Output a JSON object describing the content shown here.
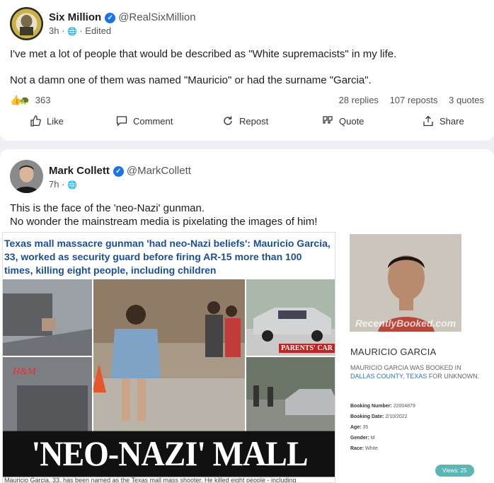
{
  "post1": {
    "author": "Six Million",
    "handle": "@RealSixMillion",
    "time": "3h",
    "edited": "Edited",
    "line1": "I've met a lot of people that would be described as \"White supremacists\" in my life.",
    "line2": "Not a damn one of them was named \"Mauricio\" or had the surname \"Garcia\".",
    "reactions_count": "363",
    "replies": "28 replies",
    "reposts": "107 reposts",
    "quotes": "3 quotes",
    "actions": {
      "like": "Like",
      "comment": "Comment",
      "repost": "Repost",
      "quote": "Quote",
      "share": "Share"
    }
  },
  "post2": {
    "author": "Mark Collett",
    "handle": "@MarkCollett",
    "time": "7h",
    "line1": "This is the face of the 'neo-Nazi' gunman.",
    "line2": "No wonder the mainstream media is pixelating the images of him!"
  },
  "news": {
    "headline": "Texas mall massacre gunman 'had neo-Nazi beliefs': Mauricio Garcia, 33, worked as security guard before firing AR-15 more than 100 times, killing eight people, including children",
    "parents_car": "PARENTS' CAR",
    "big_title": "'NEO-NAZI' MALL GUNMAN",
    "caption": "Mauricio Garcia, 33, has been named as the Texas mall mass shooter. He killed eight people - including",
    "store_sign": "H&M"
  },
  "booking": {
    "watermark": "RecentlyBooked.com",
    "name": "MAURICIO GARCIA",
    "desc_pre": "MAURICIO GARCIA WAS BOOKED IN",
    "desc_link": "DALLAS COUNTY, TEXAS",
    "desc_post": "FOR UNKNOWN.",
    "booking_number_label": "Booking Number:",
    "booking_number": "22004879",
    "booking_date_label": "Booking Date:",
    "booking_date": "2/10/2022",
    "age_label": "Age:",
    "age": "35",
    "gender_label": "Gender:",
    "gender": "M",
    "race_label": "Race:",
    "race": "White",
    "views": "Views: 25"
  },
  "colors": {
    "verified": "#1a73e8",
    "headline_blue": "#1c4e9a",
    "link_blue": "#2b73c9",
    "views_badge": "#5bb7b5"
  }
}
